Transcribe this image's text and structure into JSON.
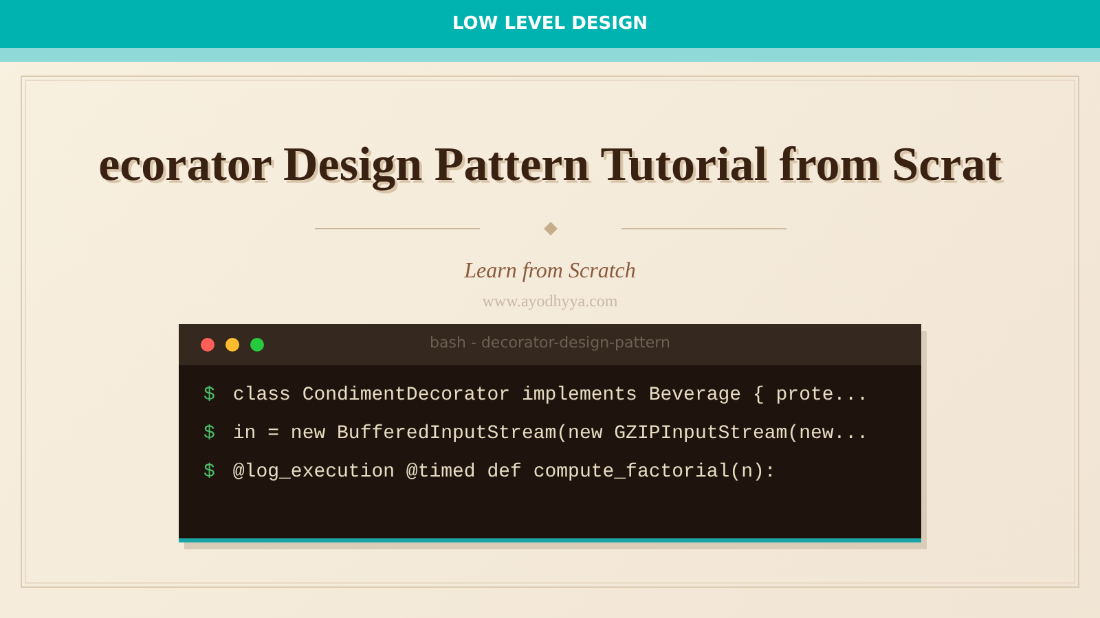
{
  "header": {
    "title": "LOW LEVEL DESIGN"
  },
  "title": "ecorator Design Pattern Tutorial from Scrat",
  "subtitle": "Learn from Scratch",
  "site": "www.ayodhyya.com",
  "terminal": {
    "title": "bash - decorator-design-pattern",
    "lines": [
      {
        "prompt": "$",
        "command": "class CondimentDecorator implements Beverage { prote..."
      },
      {
        "prompt": "$",
        "command": "in = new BufferedInputStream(new GZIPInputStream(new..."
      },
      {
        "prompt": "$",
        "command": "@log_execution @timed def compute_factorial(n):"
      }
    ]
  }
}
